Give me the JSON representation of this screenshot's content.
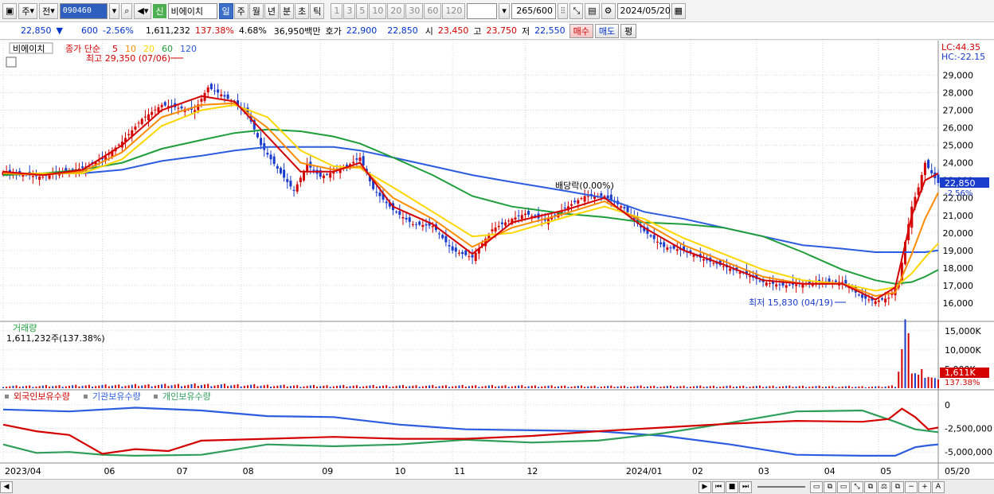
{
  "toolbar": {
    "stock_type": "주",
    "compare": "전",
    "code": "090460",
    "new_badge": "신",
    "name": "비에이치",
    "periods": [
      "일",
      "주",
      "월",
      "년",
      "분",
      "초",
      "틱"
    ],
    "active_period": "일",
    "intervals": [
      "1",
      "3",
      "5",
      "10",
      "20",
      "30",
      "60",
      "120"
    ],
    "count": "265",
    "count_total": "/600",
    "date": "2024/05/20"
  },
  "quote": {
    "price": "22,850",
    "change_arrow": "▼",
    "change": "600",
    "change_pct": "-2.56%",
    "volume": "1,611,232",
    "volume_ratio": "137.38%",
    "turnover": "4.68%",
    "amount": "36,950백만",
    "quote_label": "호가",
    "ask": "22,900",
    "bid": "22,850",
    "open_label": "시",
    "open": "23,450",
    "high_label": "고",
    "high": "23,750",
    "low_label": "저",
    "low": "22,550",
    "buy_label": "매수",
    "sell_label": "매도",
    "extra_label": "평"
  },
  "legend": {
    "name": "비에이치",
    "ma_title": "종가 단순",
    "ma_periods": [
      "5",
      "10",
      "20",
      "60",
      "120"
    ],
    "ma_colors": [
      "#d40000",
      "#ff8c00",
      "#ffd700",
      "#1e9e3a",
      "#2c5ce0"
    ],
    "lc": "LC:44.35",
    "hc": "HC:-22.15",
    "max_note": "최고 29,350 (07/06)",
    "min_note": "최저 15,830 (04/19)",
    "drop_note": "배당락(0.00%)",
    "last_price": "22,850",
    "last_pct": "-2.56%"
  },
  "volume_panel": {
    "title": "거래량",
    "value": "1,611,232주(137.38%)",
    "axis": [
      "15,000K",
      "10,000K",
      "5,000K"
    ],
    "last": "1,611K",
    "last_pct": "137.38%"
  },
  "holdings_panel": {
    "series": [
      "외국인보유수량",
      "기관보유수량",
      "개인보유수량"
    ],
    "colors": [
      "#d40000",
      "#2c5ce0",
      "#2e9e5a"
    ],
    "axis": [
      "0",
      "-2,500,000",
      "-5,000,000"
    ]
  },
  "x_axis": [
    "2023/04",
    "06",
    "07",
    "08",
    "09",
    "10",
    "11",
    "12",
    "2024/01",
    "02",
    "03",
    "04",
    "05",
    "05/20"
  ],
  "chart_data": {
    "type": "line",
    "price_ylim": [
      15000,
      29700
    ],
    "price_ticks": [
      16000,
      17000,
      18000,
      19000,
      20000,
      21000,
      22000,
      23000,
      24000,
      25000,
      26000,
      27000,
      28000,
      29000
    ],
    "close": [
      [
        0,
        23500
      ],
      [
        6,
        23300
      ],
      [
        12,
        23200
      ],
      [
        18,
        23500
      ],
      [
        24,
        23700
      ],
      [
        30,
        24200
      ],
      [
        36,
        25200
      ],
      [
        42,
        26500
      ],
      [
        48,
        27300
      ],
      [
        54,
        27100
      ],
      [
        58,
        27000
      ],
      [
        62,
        28300
      ],
      [
        66,
        27900
      ],
      [
        70,
        27400
      ],
      [
        74,
        26800
      ],
      [
        78,
        25000
      ],
      [
        84,
        23400
      ],
      [
        88,
        22400
      ],
      [
        92,
        23900
      ],
      [
        96,
        23200
      ],
      [
        100,
        23500
      ],
      [
        104,
        23800
      ],
      [
        108,
        24300
      ],
      [
        112,
        22500
      ],
      [
        118,
        21300
      ],
      [
        124,
        20500
      ],
      [
        130,
        20400
      ],
      [
        136,
        19000
      ],
      [
        142,
        18600
      ],
      [
        148,
        20200
      ],
      [
        154,
        20800
      ],
      [
        158,
        21100
      ],
      [
        164,
        20700
      ],
      [
        170,
        21400
      ],
      [
        176,
        22100
      ],
      [
        182,
        22100
      ],
      [
        188,
        21400
      ],
      [
        194,
        20100
      ],
      [
        200,
        19200
      ],
      [
        206,
        19000
      ],
      [
        212,
        18500
      ],
      [
        218,
        18100
      ],
      [
        224,
        17700
      ],
      [
        230,
        17200
      ],
      [
        236,
        17000
      ],
      [
        242,
        17100
      ],
      [
        248,
        17200
      ],
      [
        254,
        17200
      ],
      [
        260,
        16300
      ],
      [
        264,
        16100
      ],
      [
        268,
        16300
      ],
      [
        271,
        17100
      ],
      [
        273,
        19500
      ],
      [
        275,
        21500
      ],
      [
        277,
        22600
      ],
      [
        279,
        24000
      ],
      [
        281,
        23400
      ],
      [
        283,
        22850
      ]
    ],
    "ma5": [
      [
        0,
        23500
      ],
      [
        12,
        23300
      ],
      [
        24,
        23600
      ],
      [
        36,
        25000
      ],
      [
        48,
        27000
      ],
      [
        60,
        27800
      ],
      [
        70,
        27500
      ],
      [
        80,
        25500
      ],
      [
        90,
        23500
      ],
      [
        100,
        23500
      ],
      [
        108,
        24000
      ],
      [
        118,
        21500
      ],
      [
        130,
        20500
      ],
      [
        142,
        18800
      ],
      [
        154,
        20600
      ],
      [
        170,
        21300
      ],
      [
        182,
        22000
      ],
      [
        194,
        20300
      ],
      [
        206,
        19000
      ],
      [
        218,
        18200
      ],
      [
        230,
        17300
      ],
      [
        242,
        17100
      ],
      [
        254,
        17100
      ],
      [
        264,
        16200
      ],
      [
        270,
        16900
      ],
      [
        275,
        21000
      ],
      [
        279,
        23000
      ],
      [
        283,
        23400
      ]
    ],
    "ma10": [
      [
        0,
        23400
      ],
      [
        12,
        23300
      ],
      [
        24,
        23500
      ],
      [
        36,
        24600
      ],
      [
        48,
        26600
      ],
      [
        60,
        27300
      ],
      [
        70,
        27400
      ],
      [
        80,
        26000
      ],
      [
        90,
        24000
      ],
      [
        100,
        23600
      ],
      [
        108,
        23800
      ],
      [
        118,
        22000
      ],
      [
        130,
        20800
      ],
      [
        142,
        19200
      ],
      [
        154,
        20300
      ],
      [
        170,
        21100
      ],
      [
        182,
        21800
      ],
      [
        194,
        20600
      ],
      [
        206,
        19300
      ],
      [
        218,
        18400
      ],
      [
        230,
        17500
      ],
      [
        242,
        17100
      ],
      [
        254,
        17100
      ],
      [
        264,
        16400
      ],
      [
        270,
        16600
      ],
      [
        275,
        18800
      ],
      [
        279,
        20800
      ],
      [
        283,
        22300
      ]
    ],
    "ma20": [
      [
        0,
        23400
      ],
      [
        12,
        23400
      ],
      [
        24,
        23400
      ],
      [
        36,
        24200
      ],
      [
        48,
        26100
      ],
      [
        60,
        27000
      ],
      [
        70,
        27300
      ],
      [
        80,
        26600
      ],
      [
        90,
        24700
      ],
      [
        100,
        23800
      ],
      [
        108,
        23700
      ],
      [
        118,
        22600
      ],
      [
        130,
        21200
      ],
      [
        142,
        19800
      ],
      [
        154,
        20000
      ],
      [
        170,
        20900
      ],
      [
        182,
        21500
      ],
      [
        194,
        20800
      ],
      [
        206,
        19700
      ],
      [
        218,
        18800
      ],
      [
        230,
        17900
      ],
      [
        242,
        17300
      ],
      [
        254,
        17100
      ],
      [
        264,
        16700
      ],
      [
        270,
        16900
      ],
      [
        275,
        17700
      ],
      [
        279,
        18600
      ],
      [
        283,
        19400
      ]
    ],
    "ma60": [
      [
        0,
        23300
      ],
      [
        12,
        23400
      ],
      [
        24,
        23600
      ],
      [
        36,
        24000
      ],
      [
        48,
        24800
      ],
      [
        60,
        25300
      ],
      [
        70,
        25700
      ],
      [
        80,
        25900
      ],
      [
        90,
        25800
      ],
      [
        100,
        25500
      ],
      [
        108,
        25100
      ],
      [
        118,
        24300
      ],
      [
        130,
        23300
      ],
      [
        142,
        22100
      ],
      [
        154,
        21500
      ],
      [
        170,
        21100
      ],
      [
        182,
        20900
      ],
      [
        194,
        20600
      ],
      [
        206,
        20500
      ],
      [
        218,
        20300
      ],
      [
        230,
        19800
      ],
      [
        242,
        18900
      ],
      [
        254,
        17900
      ],
      [
        264,
        17300
      ],
      [
        270,
        17100
      ],
      [
        275,
        17200
      ],
      [
        279,
        17500
      ],
      [
        283,
        17900
      ]
    ],
    "ma120": [
      [
        0,
        23300
      ],
      [
        12,
        23400
      ],
      [
        24,
        23400
      ],
      [
        36,
        23600
      ],
      [
        48,
        24100
      ],
      [
        60,
        24400
      ],
      [
        70,
        24700
      ],
      [
        80,
        24900
      ],
      [
        90,
        24900
      ],
      [
        100,
        24900
      ],
      [
        108,
        24700
      ],
      [
        118,
        24300
      ],
      [
        130,
        23800
      ],
      [
        142,
        23300
      ],
      [
        154,
        22900
      ],
      [
        170,
        22400
      ],
      [
        182,
        22000
      ],
      [
        194,
        21200
      ],
      [
        206,
        20800
      ],
      [
        218,
        20300
      ],
      [
        230,
        19800
      ],
      [
        242,
        19300
      ],
      [
        254,
        19100
      ],
      [
        264,
        18900
      ],
      [
        270,
        18900
      ],
      [
        275,
        18900
      ],
      [
        279,
        18900
      ],
      [
        283,
        19000
      ]
    ],
    "volume_ylim": [
      0,
      16000
    ],
    "volume": [
      [
        0,
        500
      ],
      [
        30,
        700
      ],
      [
        60,
        900
      ],
      [
        90,
        600
      ],
      [
        120,
        600
      ],
      [
        150,
        600
      ],
      [
        180,
        500
      ],
      [
        210,
        500
      ],
      [
        240,
        500
      ],
      [
        265,
        400
      ],
      [
        270,
        600
      ],
      [
        273,
        15000
      ],
      [
        275,
        5500
      ],
      [
        277,
        3200
      ],
      [
        279,
        4500
      ],
      [
        281,
        2800
      ],
      [
        283,
        1611
      ]
    ],
    "holdings_ylim": [
      -6000000,
      500000
    ],
    "foreign": [
      [
        0,
        -2100000
      ],
      [
        10,
        -2800000
      ],
      [
        20,
        -3200000
      ],
      [
        30,
        -5200000
      ],
      [
        40,
        -4700000
      ],
      [
        50,
        -4900000
      ],
      [
        60,
        -3800000
      ],
      [
        80,
        -3600000
      ],
      [
        100,
        -3400000
      ],
      [
        120,
        -3600000
      ],
      [
        140,
        -3600000
      ],
      [
        160,
        -3300000
      ],
      [
        180,
        -2800000
      ],
      [
        200,
        -2400000
      ],
      [
        220,
        -2000000
      ],
      [
        240,
        -1700000
      ],
      [
        260,
        -1800000
      ],
      [
        268,
        -1500000
      ],
      [
        272,
        -400000
      ],
      [
        276,
        -1300000
      ],
      [
        280,
        -2600000
      ],
      [
        283,
        -2400000
      ]
    ],
    "institution": [
      [
        0,
        -500000
      ],
      [
        20,
        -700000
      ],
      [
        40,
        -300000
      ],
      [
        60,
        -600000
      ],
      [
        80,
        -1200000
      ],
      [
        100,
        -1300000
      ],
      [
        120,
        -2100000
      ],
      [
        140,
        -2600000
      ],
      [
        160,
        -2700000
      ],
      [
        180,
        -2800000
      ],
      [
        200,
        -3300000
      ],
      [
        220,
        -4200000
      ],
      [
        240,
        -5300000
      ],
      [
        260,
        -5400000
      ],
      [
        270,
        -5400000
      ],
      [
        276,
        -4500000
      ],
      [
        280,
        -4300000
      ],
      [
        283,
        -4200000
      ]
    ],
    "individual": [
      [
        0,
        -4200000
      ],
      [
        10,
        -5100000
      ],
      [
        20,
        -5000000
      ],
      [
        30,
        -5300000
      ],
      [
        40,
        -5400000
      ],
      [
        60,
        -5300000
      ],
      [
        80,
        -4200000
      ],
      [
        100,
        -4400000
      ],
      [
        120,
        -4200000
      ],
      [
        140,
        -3700000
      ],
      [
        160,
        -4000000
      ],
      [
        180,
        -3800000
      ],
      [
        200,
        -3000000
      ],
      [
        220,
        -1900000
      ],
      [
        240,
        -700000
      ],
      [
        260,
        -600000
      ],
      [
        270,
        -1800000
      ],
      [
        276,
        -2600000
      ],
      [
        283,
        -2900000
      ]
    ]
  }
}
